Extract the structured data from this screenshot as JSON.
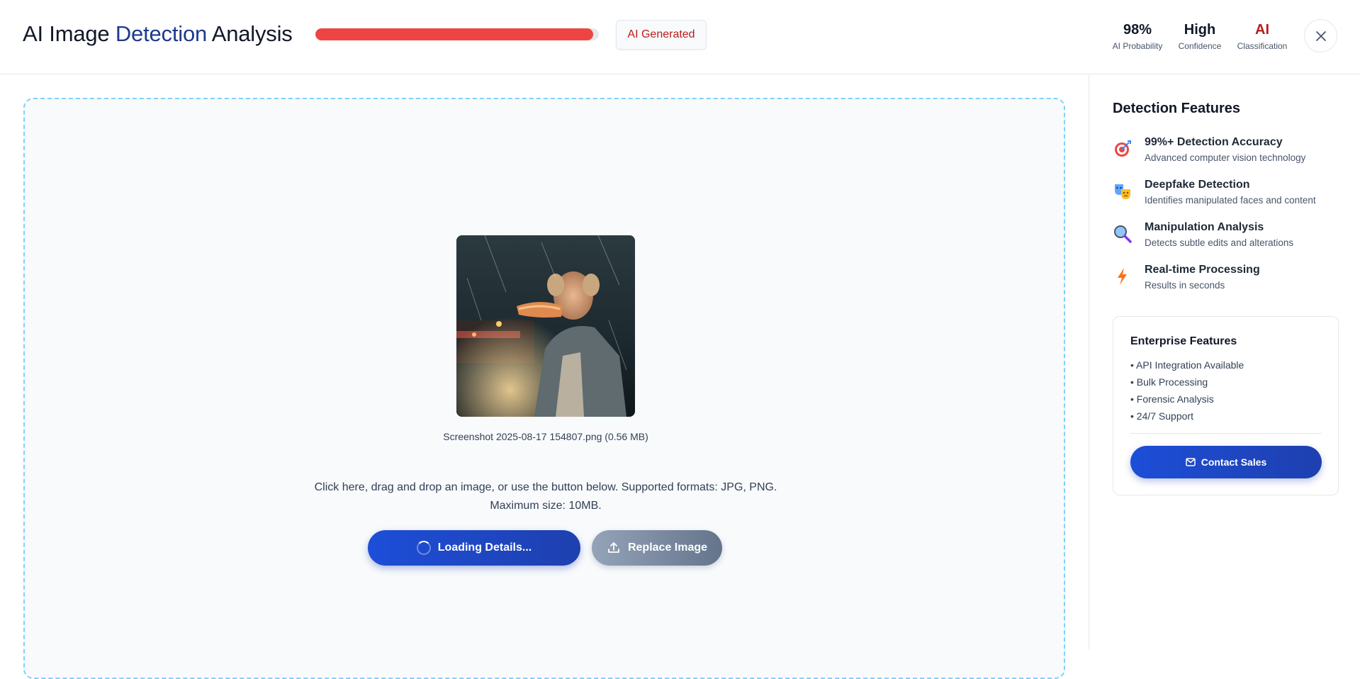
{
  "header": {
    "title_part1": "AI Image ",
    "title_accent": "Detection",
    "title_part2": " Analysis",
    "progress_percent": 98,
    "progress_color": "#ef4444",
    "badge_label": "AI Generated",
    "stats": [
      {
        "value": "98%",
        "label": "AI Probability"
      },
      {
        "value": "High",
        "label": "Confidence"
      },
      {
        "value": "AI",
        "label": "Classification"
      }
    ],
    "close_icon": "close-icon"
  },
  "upload": {
    "file_name": "Screenshot 2025-08-17 154807.png (0.56 MB)",
    "instructions_line1": "Click here, drag and drop an image, or use the button below. Supported formats: JPG, PNG.",
    "instructions_line2": "Maximum size: 10MB.",
    "primary_button": "Loading Details...",
    "secondary_button": "Replace Image"
  },
  "sidebar": {
    "title": "Detection Features",
    "features": [
      {
        "icon": "target-icon",
        "title": "99%+ Detection Accuracy",
        "desc": "Advanced computer vision technology"
      },
      {
        "icon": "masks-icon",
        "title": "Deepfake Detection",
        "desc": "Identifies manipulated faces and content"
      },
      {
        "icon": "magnifier-icon",
        "title": "Manipulation Analysis",
        "desc": "Detects subtle edits and alterations"
      },
      {
        "icon": "lightning-icon",
        "title": "Real-time Processing",
        "desc": "Results in seconds"
      }
    ],
    "enterprise": {
      "title": "Enterprise Features",
      "items": [
        "• API Integration Available",
        "• Bulk Processing",
        "• Forensic Analysis",
        "• 24/7 Support"
      ],
      "contact_button": "Contact Sales"
    }
  },
  "colors": {
    "accent": "#1e40af",
    "danger": "#b91c1c",
    "dropzone_border": "#7dd3fc"
  }
}
